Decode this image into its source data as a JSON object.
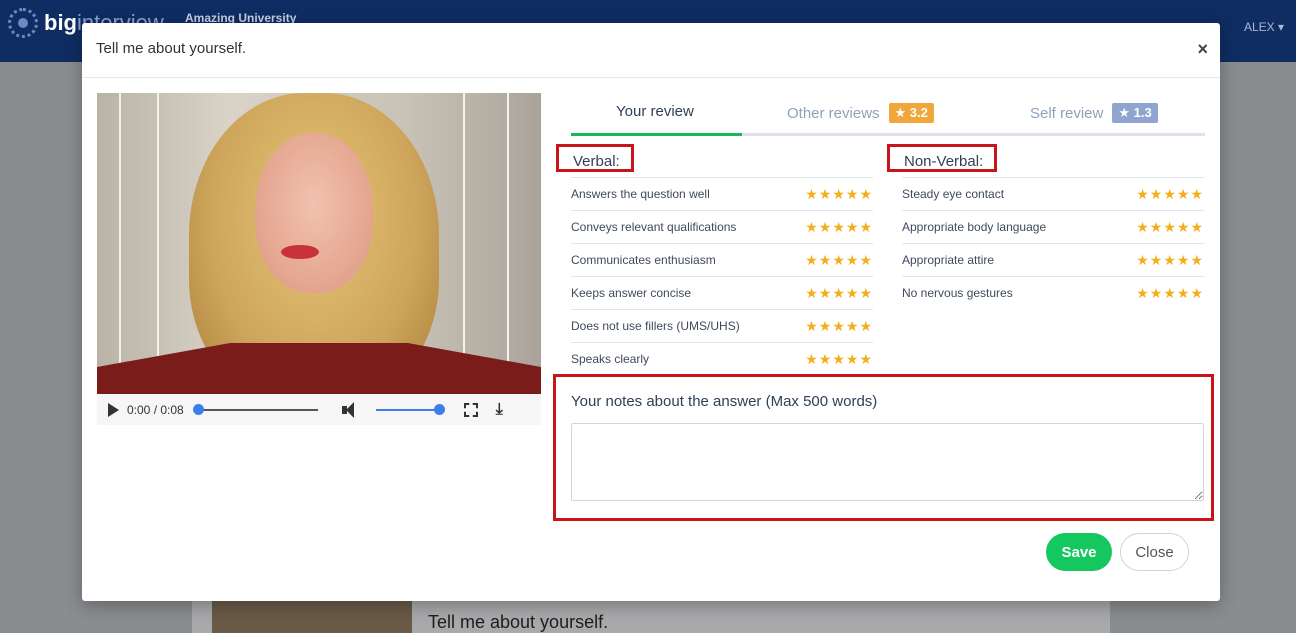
{
  "app": {
    "logo_text_1": "big",
    "logo_text_2": "interview",
    "org_name": "Amazing University",
    "user": "ALEX ▾"
  },
  "background": {
    "question_title": "Tell me about yourself."
  },
  "modal": {
    "title": "Tell me about yourself.",
    "close_symbol": "×"
  },
  "video": {
    "time": "0:00 / 0:08",
    "download_symbol": "⤓"
  },
  "tabs": [
    {
      "label": "Your review",
      "active": true
    },
    {
      "label": "Other reviews",
      "badge": "★ 3.2"
    },
    {
      "label": "Self review",
      "badge": "★ 1.3"
    }
  ],
  "verbal": {
    "heading": "Verbal:",
    "items": [
      {
        "label": "Answers the question well",
        "stars": "★★★★★"
      },
      {
        "label": "Conveys relevant qualifications",
        "stars": "★★★★★"
      },
      {
        "label": "Communicates enthusiasm",
        "stars": "★★★★★"
      },
      {
        "label": "Keeps answer concise",
        "stars": "★★★★★"
      },
      {
        "label": "Does not use fillers (UMS/UHS)",
        "stars": "★★★★★"
      },
      {
        "label": "Speaks clearly",
        "stars": "★★★★★"
      }
    ]
  },
  "nonverbal": {
    "heading": "Non-Verbal:",
    "items": [
      {
        "label": "Steady eye contact",
        "stars": "★★★★★"
      },
      {
        "label": "Appropriate body language",
        "stars": "★★★★★"
      },
      {
        "label": "Appropriate attire",
        "stars": "★★★★★"
      },
      {
        "label": "No nervous gestures",
        "stars": "★★★★★"
      }
    ]
  },
  "notes": {
    "label": "Your notes about the answer (Max 500 words)",
    "value": ""
  },
  "actions": {
    "save_label": "Save",
    "close_label": "Close"
  },
  "colors": {
    "accent_green": "#15c75f",
    "highlight_red": "#c8141b",
    "badge_orange": "#f0a63a",
    "badge_blue": "#8fa4cf",
    "star": "#f3ae1b"
  }
}
